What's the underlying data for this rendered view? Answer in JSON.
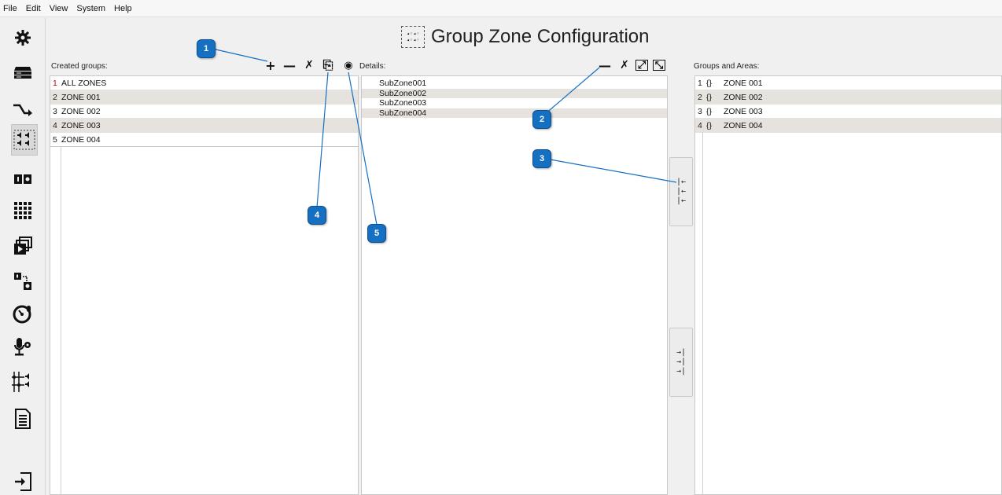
{
  "menu": [
    "File",
    "Edit",
    "View",
    "System",
    "Help"
  ],
  "title": {
    "icon_line1": "◂◦◂◦",
    "icon_line2": "◂◦◂◦",
    "text": "Group Zone Configuration"
  },
  "created_groups": {
    "label": "Created groups:",
    "toolbar": {
      "add": "+",
      "remove": "—",
      "clear": "✗",
      "copy": "⎘",
      "view": "◉"
    },
    "rows": [
      {
        "index": "1",
        "name": "ALL ZONES"
      },
      {
        "index": "2",
        "name": "ZONE 001"
      },
      {
        "index": "3",
        "name": "ZONE 002"
      },
      {
        "index": "4",
        "name": "ZONE 003"
      },
      {
        "index": "5",
        "name": "ZONE 004"
      }
    ]
  },
  "details": {
    "label": "Details:",
    "toolbar": {
      "remove": "—",
      "clear": "✗",
      "expand": "⤢",
      "collapse": "⤡"
    },
    "rows": [
      "SubZone001",
      "SubZone002",
      "SubZone003",
      "SubZone004"
    ]
  },
  "groups_and_areas": {
    "label": "Groups and Areas:",
    "rows": [
      {
        "index": "1",
        "brace": "{}",
        "name": "ZONE 001"
      },
      {
        "index": "2",
        "brace": "{}",
        "name": "ZONE 002"
      },
      {
        "index": "3",
        "brace": "{}",
        "name": "ZONE 003"
      },
      {
        "index": "4",
        "brace": "{}",
        "name": "ZONE 004"
      }
    ]
  },
  "move_buttons": {
    "add_to_details": [
      "|←",
      "|←",
      "|←"
    ],
    "remove_from_details": [
      "→|",
      "→|",
      "→|"
    ]
  },
  "callouts": [
    "1",
    "2",
    "3",
    "4",
    "5"
  ],
  "nav_icons": [
    "gear-icon",
    "server-icon",
    "route-icon",
    "group-zone-icon",
    "io-icon",
    "matrix-icon",
    "media-icon",
    "mapping-icon",
    "gauge-icon",
    "mic-settings-icon",
    "mixer-icon",
    "document-icon",
    "logout-icon"
  ],
  "colors": {
    "callout": "#1670c2",
    "alt_row": "#e6e3df",
    "index_red": "#c00000"
  }
}
